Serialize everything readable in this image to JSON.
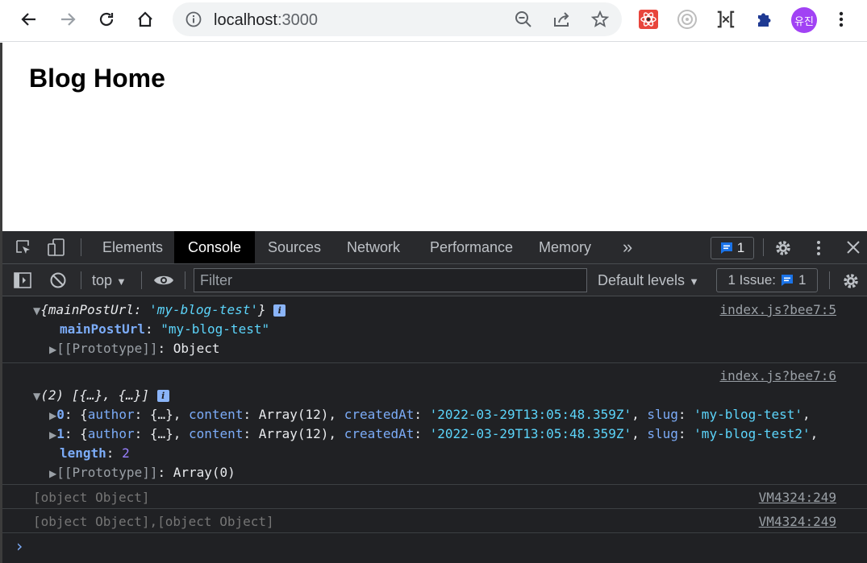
{
  "browser": {
    "url_host": "localhost",
    "url_port": ":3000",
    "avatar_text": "유진",
    "icons": [
      "back-icon",
      "forward-icon",
      "reload-icon",
      "home-icon",
      "info-icon",
      "zoom-out-icon",
      "share-icon",
      "star-icon",
      "react-devtools-icon",
      "circle-extension-icon",
      "bracket-extension-icon",
      "puzzle-extensions-icon",
      "kebab-menu-icon"
    ]
  },
  "page": {
    "heading": "Blog Home"
  },
  "devtools": {
    "tabs": [
      "Elements",
      "Console",
      "Sources",
      "Network",
      "Performance",
      "Memory"
    ],
    "active_tab": "Console",
    "more_tabs": "»",
    "issues_count": "1",
    "filterbar": {
      "context": "top",
      "filter_placeholder": "Filter",
      "levels": "Default levels",
      "issue_label": "1 Issue:",
      "issue_count": "1"
    },
    "messages": [
      {
        "source": "index.js?bee7:5",
        "summary_key": "mainPostUrl",
        "summary_value": "'my-blog-test'",
        "prop_key": "mainPostUrl",
        "prop_value": "\"my-blog-test\"",
        "proto": "[[Prototype]]",
        "proto_value": "Object"
      },
      {
        "source": "index.js?bee7:6",
        "summary": "(2) [{…}, {…}]",
        "items": [
          {
            "index": "0",
            "author": "{…}",
            "content": "Array(12)",
            "createdAt": "'2022-03-29T13:05:48.359Z'",
            "slug": "'my-blog-test'"
          },
          {
            "index": "1",
            "author": "{…}",
            "content": "Array(12)",
            "createdAt": "'2022-03-29T13:05:48.359Z'",
            "slug": "'my-blog-test2'"
          }
        ],
        "length_key": "length",
        "length_value": "2",
        "proto": "[[Prototype]]",
        "proto_value": "Array(0)"
      },
      {
        "text": "[object Object]",
        "source": "VM4324:249"
      },
      {
        "text": "[object Object],[object Object]",
        "source": "VM4324:249"
      }
    ],
    "prompt": "›"
  }
}
